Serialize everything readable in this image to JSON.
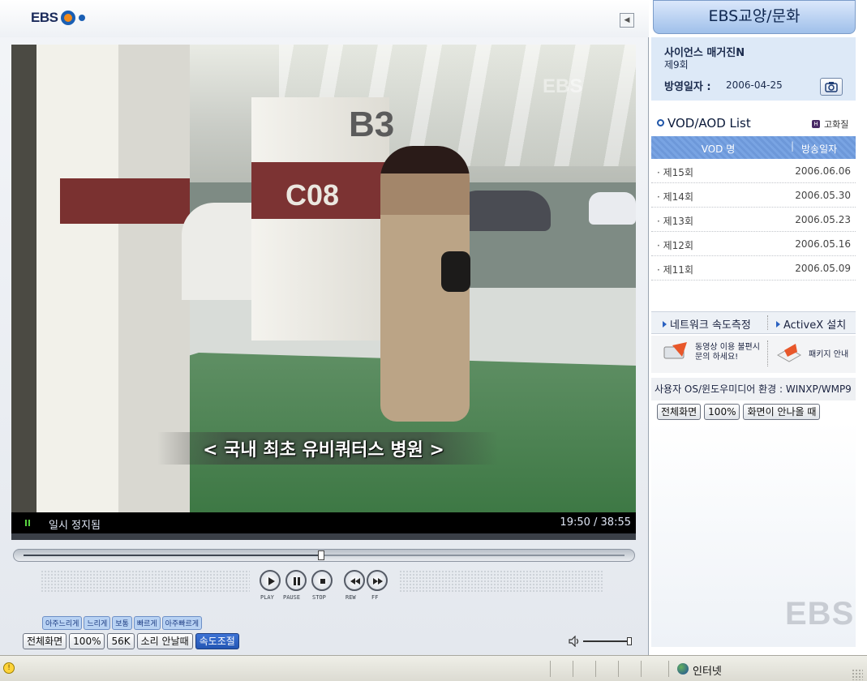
{
  "player": {
    "logo_text": "EBS",
    "status_text": "일시 정지됨",
    "time_text": "19:50 / 38:55",
    "progress_fraction": 0.495,
    "caption": "< 국내 최초 유비쿼터스 병원 >",
    "scene_labels": {
      "pillar": "C08",
      "level": "B3",
      "watermark": "EBS"
    },
    "controls": {
      "play_label": "PLAY",
      "pause_label": "PAUSE",
      "stop_label": "STOP",
      "rew_label": "REW",
      "ff_label": "FF"
    },
    "speed_options": [
      "아주느리게",
      "느리게",
      "보통",
      "빠르게",
      "아주빠르게"
    ],
    "bottom_buttons": {
      "fullscreen": "전체화면",
      "zoom": "100%",
      "bandwidth": "56K",
      "no_sound": "소리 안날때",
      "speed": "속도조절"
    },
    "volume_fraction": 1.0
  },
  "side": {
    "header": "EBS교양/문화",
    "program": {
      "title": "사이언스 매거진N",
      "episode": "제9회",
      "date_label": "방영일자 :",
      "date": "2006-04-25"
    },
    "vod": {
      "title": "VOD/AOD List",
      "quality_badge": "H",
      "quality_label": "고화질",
      "columns": [
        "VOD 명",
        "방송일자"
      ],
      "rows": [
        {
          "ep": "· 제15회",
          "date": "2006.06.06"
        },
        {
          "ep": "· 제14회",
          "date": "2006.05.30"
        },
        {
          "ep": "· 제13회",
          "date": "2006.05.23"
        },
        {
          "ep": "· 제12회",
          "date": "2006.05.16"
        },
        {
          "ep": "· 제11회",
          "date": "2006.05.09"
        }
      ]
    },
    "network_test": "네트워크 속도측정",
    "activex": "ActiveX 설치",
    "help_line1": "동영상 이용 불편시",
    "help_line2": "문의 하세요!",
    "package": "패키지 안내",
    "env_text": "사용자 OS/윈도우미디어 환경 : WINXP/WMP9",
    "buttons": {
      "fullscreen": "전체화면",
      "zoom": "100%",
      "ratio": "화면이 안나올 때"
    },
    "footer_logo": "EBS"
  },
  "statusbar": {
    "zone": "인터넷"
  },
  "colors": {
    "accent": "#2456b3",
    "header_bg": "#9fc0ea",
    "table_head": "#79a4e3"
  }
}
